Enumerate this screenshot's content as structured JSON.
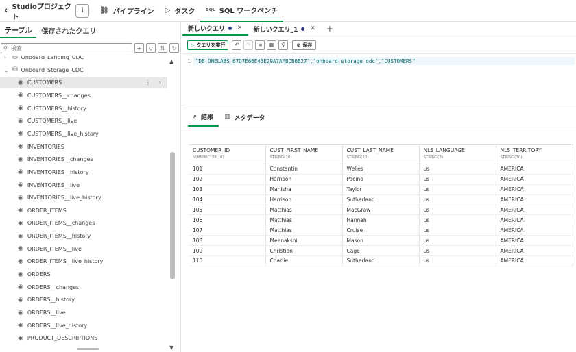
{
  "topbar": {
    "back_label": "Studioプロジェクト",
    "info_label": "i",
    "tabs": [
      {
        "icon": "pipeline-icon",
        "glyph": "⛓",
        "label": "パイプライン"
      },
      {
        "icon": "task-icon",
        "glyph": "▷",
        "label": "タスク"
      },
      {
        "icon": "sql-icon",
        "glyph": "SQL",
        "label": "SQL ワークベンチ"
      }
    ]
  },
  "left": {
    "tabs": [
      "テーブル",
      "保存されたクエリ"
    ],
    "search_placeholder": "検索",
    "tree": [
      {
        "type": "db",
        "label": "Onboard_Landing_CDC",
        "expanded": false
      },
      {
        "type": "db",
        "label": "Onboard_Storage_CDC",
        "expanded": true
      },
      {
        "type": "table",
        "label": "CUSTOMERS",
        "selected": true
      },
      {
        "type": "table",
        "label": "CUSTOMERS__changes"
      },
      {
        "type": "table",
        "label": "CUSTOMERS__history"
      },
      {
        "type": "table",
        "label": "CUSTOMERS__live"
      },
      {
        "type": "table",
        "label": "CUSTOMERS__live_history"
      },
      {
        "type": "table",
        "label": "INVENTORIES"
      },
      {
        "type": "table",
        "label": "INVENTORIES__changes"
      },
      {
        "type": "table",
        "label": "INVENTORIES__history"
      },
      {
        "type": "table",
        "label": "INVENTORIES__live"
      },
      {
        "type": "table",
        "label": "INVENTORIES__live_history"
      },
      {
        "type": "table",
        "label": "ORDER_ITEMS"
      },
      {
        "type": "table",
        "label": "ORDER_ITEMS__changes"
      },
      {
        "type": "table",
        "label": "ORDER_ITEMS__history"
      },
      {
        "type": "table",
        "label": "ORDER_ITEMS__live"
      },
      {
        "type": "table",
        "label": "ORDER_ITEMS__live_history"
      },
      {
        "type": "table",
        "label": "ORDERS"
      },
      {
        "type": "table",
        "label": "ORDERS__changes"
      },
      {
        "type": "table",
        "label": "ORDERS__history"
      },
      {
        "type": "table",
        "label": "ORDERS__live"
      },
      {
        "type": "table",
        "label": "ORDERS__live_history"
      },
      {
        "type": "table",
        "label": "PRODUCT_DESCRIPTIONS"
      }
    ]
  },
  "query_tabs": [
    {
      "label": "新しいクエリ",
      "active": true
    },
    {
      "label": "新しいクエリ_1",
      "active": false
    }
  ],
  "toolbar": {
    "run_label": "クエリを実行",
    "save_label": "保存"
  },
  "editor": {
    "line_number": "1",
    "code": "\"DB_ONELABS_67D7E66E43E29A7AFBCB6B27\".\"onboard_storage_cdc\".\"CUSTOMERS\""
  },
  "results_tabs": [
    "結果",
    "メタデータ"
  ],
  "table": {
    "columns": [
      {
        "name": "CUSTOMER_ID",
        "type": "NUMERIC(38 , 0)"
      },
      {
        "name": "CUST_FIRST_NAME",
        "type": "STRING(20)"
      },
      {
        "name": "CUST_LAST_NAME",
        "type": "STRING(20)"
      },
      {
        "name": "NLS_LANGUAGE",
        "type": "STRING(3)"
      },
      {
        "name": "NLS_TERRITORY",
        "type": "STRING(30)"
      }
    ],
    "rows": [
      [
        "101",
        "Constantin",
        "Welles",
        "us",
        "AMERICA"
      ],
      [
        "102",
        "Harrison",
        "Pacino",
        "us",
        "AMERICA"
      ],
      [
        "103",
        "Manisha",
        "Taylor",
        "us",
        "AMERICA"
      ],
      [
        "104",
        "Harrison",
        "Sutherland",
        "us",
        "AMERICA"
      ],
      [
        "105",
        "Matthias",
        "MacGraw",
        "us",
        "AMERICA"
      ],
      [
        "106",
        "Matthias",
        "Hannah",
        "us",
        "AMERICA"
      ],
      [
        "107",
        "Matthias",
        "Cruise",
        "us",
        "AMERICA"
      ],
      [
        "108",
        "Meenakshi",
        "Mason",
        "us",
        "AMERICA"
      ],
      [
        "109",
        "Christian",
        "Cage",
        "us",
        "AMERICA"
      ],
      [
        "110",
        "Charlie",
        "Sutherland",
        "us",
        "AMERICA"
      ]
    ]
  },
  "colors": {
    "accent": "#009845",
    "unsaved_dot": "#333d8c"
  }
}
